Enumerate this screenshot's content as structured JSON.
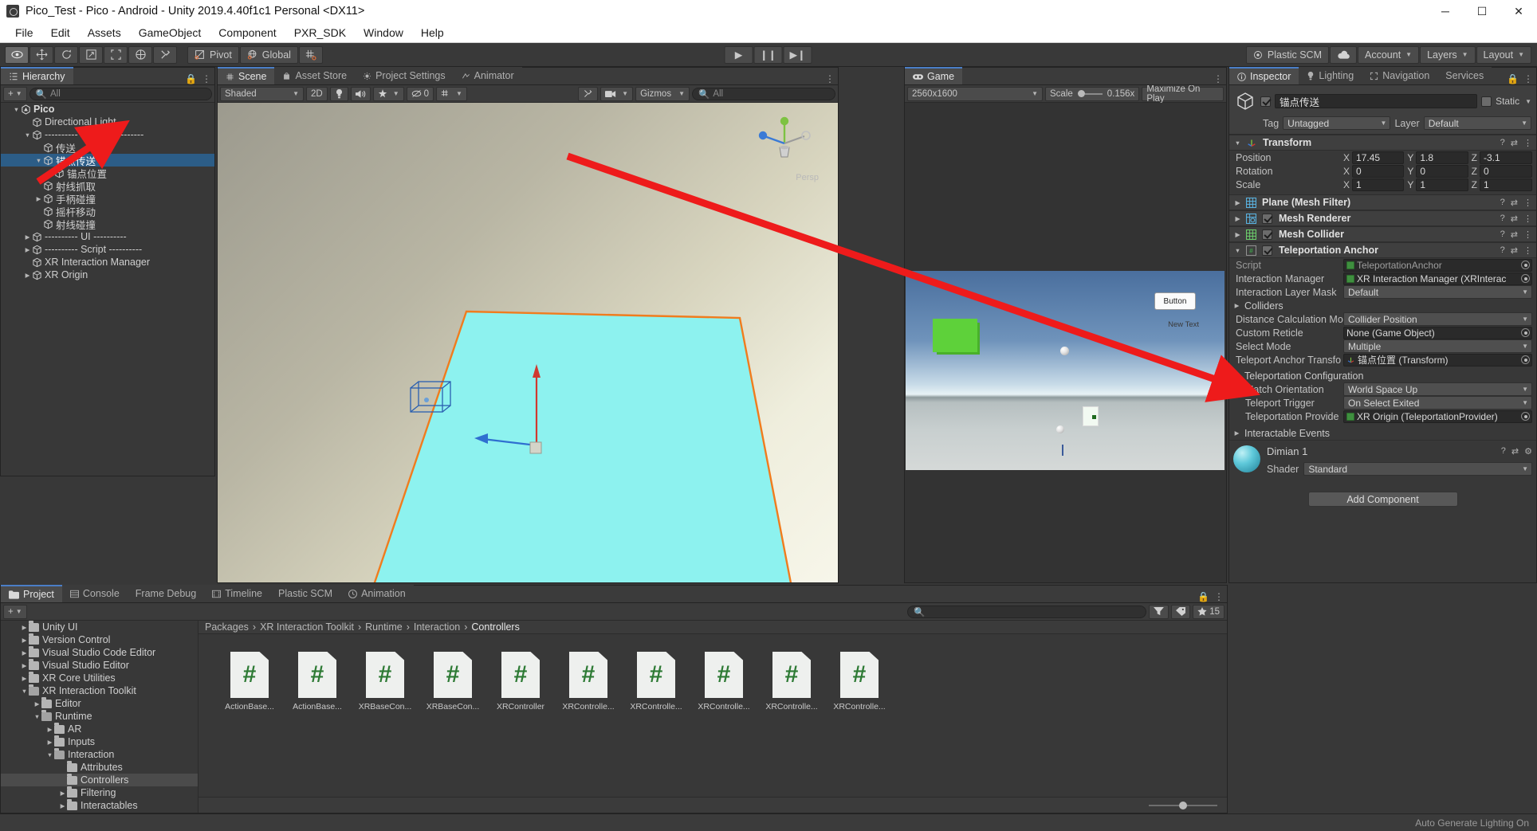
{
  "window": {
    "title": "Pico_Test - Pico - Android - Unity 2019.4.40f1c1 Personal <DX11>",
    "minimize": "─",
    "maximize": "☐",
    "close": "✕"
  },
  "menubar": {
    "items": [
      "File",
      "Edit",
      "Assets",
      "GameObject",
      "Component",
      "PXR_SDK",
      "Window",
      "Help"
    ]
  },
  "toolbar": {
    "tools": [
      "hand-tool",
      "move-tool",
      "rotate-tool",
      "scale-tool",
      "rect-tool",
      "transform-tool",
      "custom-tool"
    ],
    "pivot_label": "Pivot",
    "global_label": "Global",
    "snap_label": "grid-snap",
    "play": "▶",
    "pause": "❙❙",
    "step": "▶❙",
    "plastic_scm": "Plastic SCM",
    "cloud": "cloud",
    "account": "Account",
    "layers": "Layers",
    "layout": "Layout"
  },
  "hierarchy": {
    "tab": "Hierarchy",
    "add_label": "+",
    "search_placeholder": "All",
    "rows": [
      {
        "label": "Pico",
        "depth": 0,
        "arrow": "▼",
        "icon": "unity-scene-icon",
        "selected": false,
        "root": true
      },
      {
        "label": "Directional Light",
        "depth": 1,
        "arrow": "",
        "icon": "cube-icon",
        "selected": false
      },
      {
        "label": "---------- Model ----------",
        "depth": 1,
        "arrow": "▼",
        "icon": "cube-icon",
        "selected": false
      },
      {
        "label": "传送",
        "depth": 2,
        "arrow": "",
        "icon": "cube-icon",
        "selected": false
      },
      {
        "label": "锚点传送",
        "depth": 2,
        "arrow": "▼",
        "icon": "cube-icon",
        "selected": true
      },
      {
        "label": "锚点位置",
        "depth": 3,
        "arrow": "",
        "icon": "cube-icon",
        "selected": false
      },
      {
        "label": "射线抓取",
        "depth": 2,
        "arrow": "",
        "icon": "cube-icon",
        "selected": false
      },
      {
        "label": "手柄碰撞",
        "depth": 2,
        "arrow": "▶",
        "icon": "cube-icon",
        "selected": false
      },
      {
        "label": "摇杆移动",
        "depth": 2,
        "arrow": "",
        "icon": "cube-icon",
        "selected": false
      },
      {
        "label": "射线碰撞",
        "depth": 2,
        "arrow": "",
        "icon": "cube-icon",
        "selected": false
      },
      {
        "label": "---------- UI ----------",
        "depth": 1,
        "arrow": "▶",
        "icon": "cube-icon",
        "selected": false
      },
      {
        "label": "---------- Script ----------",
        "depth": 1,
        "arrow": "▶",
        "icon": "cube-icon",
        "selected": false
      },
      {
        "label": "XR Interaction Manager",
        "depth": 1,
        "arrow": "",
        "icon": "cube-icon",
        "selected": false
      },
      {
        "label": "XR Origin",
        "depth": 1,
        "arrow": "▶",
        "icon": "cube-icon",
        "selected": false
      }
    ]
  },
  "scene": {
    "tabs": [
      {
        "label": "Scene",
        "icon": "scene-icon",
        "selected": true
      },
      {
        "label": "Asset Store",
        "icon": "store-icon",
        "selected": false
      },
      {
        "label": "Project Settings",
        "icon": "gear-icon",
        "selected": false
      },
      {
        "label": "Animator",
        "icon": "animator-icon",
        "selected": false
      }
    ],
    "shading": "Shaded",
    "mode_2d": "2D",
    "light_icon": "lighting-icon",
    "audio_icon": "audio-icon",
    "fx_icon": "effects-icon",
    "hidden_count": "0",
    "grid_icon": "grid-icon",
    "tools_icon": "tools-icon",
    "camera_icon": "camera-icon",
    "gizmos": "Gizmos",
    "search_placeholder": "All",
    "persp_label": "Persp"
  },
  "game": {
    "tab": "Game",
    "resolution": "2560x1600",
    "scale_label": "Scale",
    "scale_value": "0.156x",
    "maximize_on_play": "Maximize On Play",
    "button_label": "Button",
    "text_label": "New Text"
  },
  "inspector": {
    "tabs": [
      {
        "label": "Inspector",
        "icon": "info-icon",
        "selected": true
      },
      {
        "label": "Lighting",
        "icon": "bulb-icon",
        "selected": false
      },
      {
        "label": "Navigation",
        "icon": "navigation-icon",
        "selected": false
      },
      {
        "label": "Services",
        "icon": "services-icon",
        "selected": false
      }
    ],
    "object_name": "锚点传送",
    "enabled": true,
    "static_label": "Static",
    "tag_label": "Tag",
    "tag_value": "Untagged",
    "layer_label": "Layer",
    "layer_value": "Default",
    "transform": {
      "title": "Transform",
      "position_label": "Position",
      "rotation_label": "Rotation",
      "scale_label": "Scale",
      "position": {
        "x": "17.45",
        "y": "1.8",
        "z": "-3.1"
      },
      "rotation": {
        "x": "0",
        "y": "0",
        "z": "0"
      },
      "scale": {
        "x": "1",
        "y": "1",
        "z": "1"
      }
    },
    "components": [
      {
        "title": "Plane (Mesh Filter)",
        "has_checkbox": false,
        "icon": "mesh-filter-icon"
      },
      {
        "title": "Mesh Renderer",
        "has_checkbox": true,
        "icon": "mesh-renderer-icon"
      },
      {
        "title": "Mesh Collider",
        "has_checkbox": true,
        "icon": "mesh-collider-icon"
      }
    ],
    "teleportation_anchor": {
      "title": "Teleportation Anchor",
      "enabled": true,
      "script_label": "Script",
      "script_value": "TeleportationAnchor",
      "interaction_manager_label": "Interaction Manager",
      "interaction_manager_value": "XR Interaction Manager (XRInterac",
      "interaction_layer_mask_label": "Interaction Layer Mask",
      "interaction_layer_mask_value": "Default",
      "colliders_label": "Colliders",
      "distance_calc_label": "Distance Calculation Mo",
      "distance_calc_value": "Collider Position",
      "custom_reticle_label": "Custom Reticle",
      "custom_reticle_value": "None (Game Object)",
      "select_mode_label": "Select Mode",
      "select_mode_value": "Multiple",
      "teleport_anchor_label": "Teleport Anchor Transfo",
      "teleport_anchor_value": "锚点位置 (Transform)"
    },
    "teleportation_config": {
      "title": "Teleportation Configuration",
      "match_orientation_label": "Match Orientation",
      "match_orientation_value": "World Space Up",
      "teleport_trigger_label": "Teleport Trigger",
      "teleport_trigger_value": "On Select Exited",
      "teleportation_provider_label": "Teleportation Provide",
      "teleportation_provider_value": "XR Origin (TeleportationProvider)"
    },
    "interactable_events_label": "Interactable Events",
    "material": {
      "name": "Dimian 1",
      "shader_label": "Shader",
      "shader_value": "Standard"
    },
    "add_component": "Add Component"
  },
  "project": {
    "tabs": [
      {
        "label": "Project",
        "icon": "folder-icon",
        "selected": true
      },
      {
        "label": "Console",
        "icon": "console-icon",
        "selected": false
      },
      {
        "label": "Frame Debug",
        "icon": "",
        "selected": false
      },
      {
        "label": "Timeline",
        "icon": "timeline-icon",
        "selected": false
      },
      {
        "label": "Plastic SCM",
        "icon": "",
        "selected": false
      },
      {
        "label": "Animation",
        "icon": "clock-icon",
        "selected": false
      }
    ],
    "add_label": "+",
    "search_placeholder": "",
    "badge_count": "15",
    "tree": [
      {
        "label": "Unity UI",
        "depth": 1,
        "arrow": "▶",
        "selected": false,
        "open": false
      },
      {
        "label": "Version Control",
        "depth": 1,
        "arrow": "▶",
        "selected": false,
        "open": false
      },
      {
        "label": "Visual Studio Code Editor",
        "depth": 1,
        "arrow": "▶",
        "selected": false,
        "open": false
      },
      {
        "label": "Visual Studio Editor",
        "depth": 1,
        "arrow": "▶",
        "selected": false,
        "open": false
      },
      {
        "label": "XR Core Utilities",
        "depth": 1,
        "arrow": "▶",
        "selected": false,
        "open": false
      },
      {
        "label": "XR Interaction Toolkit",
        "depth": 1,
        "arrow": "▼",
        "selected": false,
        "open": true
      },
      {
        "label": "Editor",
        "depth": 2,
        "arrow": "▶",
        "selected": false,
        "open": false
      },
      {
        "label": "Runtime",
        "depth": 2,
        "arrow": "▼",
        "selected": false,
        "open": true
      },
      {
        "label": "AR",
        "depth": 3,
        "arrow": "▶",
        "selected": false,
        "open": false
      },
      {
        "label": "Inputs",
        "depth": 3,
        "arrow": "▶",
        "selected": false,
        "open": false
      },
      {
        "label": "Interaction",
        "depth": 3,
        "arrow": "▼",
        "selected": false,
        "open": true
      },
      {
        "label": "Attributes",
        "depth": 4,
        "arrow": "",
        "selected": false,
        "open": false
      },
      {
        "label": "Controllers",
        "depth": 4,
        "arrow": "",
        "selected": true,
        "open": false
      },
      {
        "label": "Filtering",
        "depth": 4,
        "arrow": "▶",
        "selected": false,
        "open": false
      },
      {
        "label": "Interactables",
        "depth": 4,
        "arrow": "▶",
        "selected": false,
        "open": false
      }
    ],
    "breadcrumb": [
      "Packages",
      "XR Interaction Toolkit",
      "Runtime",
      "Interaction",
      "Controllers"
    ],
    "assets": [
      {
        "label": "ActionBase...",
        "icon": "csharp-script-icon"
      },
      {
        "label": "ActionBase...",
        "icon": "csharp-script-icon"
      },
      {
        "label": "XRBaseCon...",
        "icon": "csharp-script-icon"
      },
      {
        "label": "XRBaseCon...",
        "icon": "csharp-script-icon"
      },
      {
        "label": "XRController",
        "icon": "csharp-script-icon"
      },
      {
        "label": "XRControlle...",
        "icon": "csharp-script-icon"
      },
      {
        "label": "XRControlle...",
        "icon": "csharp-script-icon"
      },
      {
        "label": "XRControlle...",
        "icon": "csharp-script-icon"
      },
      {
        "label": "XRControlle...",
        "icon": "csharp-script-icon"
      },
      {
        "label": "XRControlle...",
        "icon": "csharp-script-icon"
      }
    ]
  },
  "statusbar": {
    "text": "Auto Generate Lighting On"
  },
  "colors": {
    "accent_blue": "#4a7ec7",
    "selection_blue": "#2c5d87",
    "annotation_red": "#ee1b1b",
    "panel_bg": "#383838",
    "header_bg": "#3b3b3b"
  }
}
